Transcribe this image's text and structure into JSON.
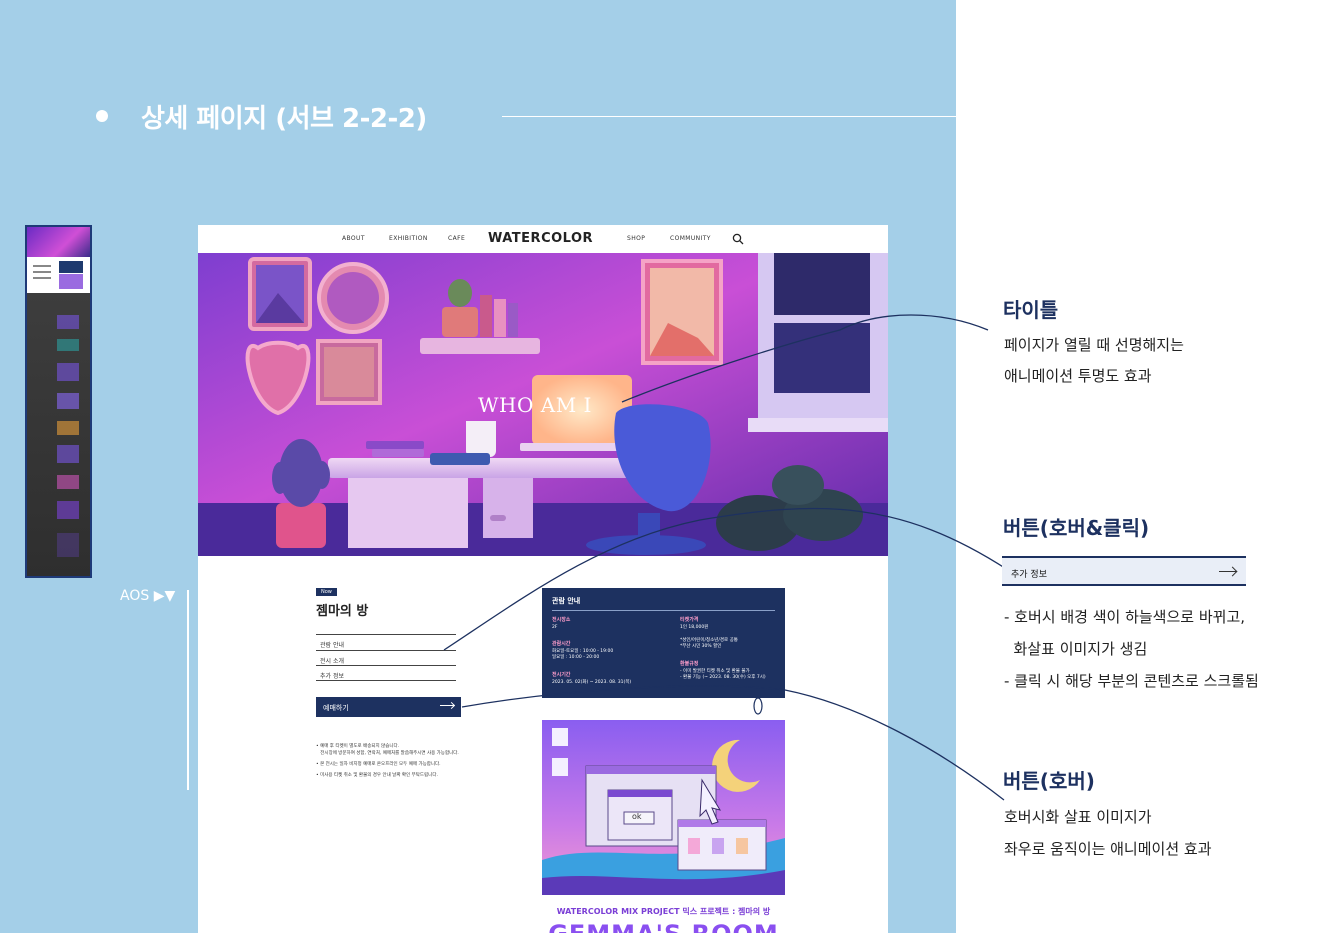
{
  "section": {
    "title": "상세 페이지 (서브 2-2-2)"
  },
  "aos_label": "AOS ▶▼",
  "site": {
    "nav": {
      "items_left": [
        "ABOUT",
        "EXHIBITION",
        "CAFE"
      ],
      "logo": "WATERCOLOR",
      "items_right": [
        "SHOP",
        "COMMUNITY"
      ]
    },
    "hero_title": "WHO AM I",
    "badge": "Now",
    "room_title": "젬마의 방",
    "menu": [
      "관람 안내",
      "전시 소개",
      "추가 정보"
    ],
    "ticket_button": "예매하기",
    "notes": [
      "• 예매 후 티켓이 별도로 배송되지 않습니다.\n   전시장에 방문하여 성함, 연락처, 예매처를 말씀해주시면 사용 가능합니다.",
      "• 본 전시는 일자 비지정 예매로 온오프라인 모두 예매 가능합니다.",
      "• 미사용 티켓 취소 및 환불의 경우 안내 날짜 확인 부탁드립니다."
    ],
    "info": {
      "heading": "관람 안내",
      "place_label": "전시장소",
      "place_value": "2F",
      "hours_label": "관람시간",
      "hours_value": "화요일-토요일 : 10:00 - 19:00\n일요일 : 10:00 - 20:00",
      "period_label": "전시기간",
      "period_value": "2023. 05. 02(화) ~ 2023. 08. 31(목)",
      "price_label": "티켓가격",
      "price_value": "1인 18,000원",
      "discount_value": "*성인/어린이/청소년/경로 공통\n*부산 시민 30% 할인",
      "refund_label": "환불규정",
      "refund_value": "- 이미 발권한 티켓 취소 및 환불 불가\n- 환불 기능 (~ 2023. 08. 30(수) 오후 7시)"
    },
    "poster": {
      "ok_label": "ok",
      "caption": "WATERCOLOR MIX PROJECT   믹스 프로젝트 : 젬마의 방",
      "big_title": "GEMMA'S ROOM"
    }
  },
  "annotations": [
    {
      "heading": "타이틀",
      "lines": [
        "페이지가 열릴 때 선명해지는",
        "애니메이션 투명도 효과"
      ]
    },
    {
      "heading": "버튼(호버&클릭)",
      "demo_button": "추가 정보",
      "lines": [
        "- 호버시 배경 색이 하늘색으로 바뀌고,",
        "  화살표 이미지가 생김",
        "- 클릭 시 해당 부분의 콘텐츠로 스크롤됨"
      ]
    },
    {
      "heading": "버튼(호버)",
      "lines": [
        "호버시화 살표 이미지가",
        "좌우로 움직이는 애니메이션 효과"
      ]
    }
  ],
  "colors": {
    "left_background": "#a4cfe8",
    "navy": "#1d3160",
    "hero_purple": "#b23fd0"
  }
}
